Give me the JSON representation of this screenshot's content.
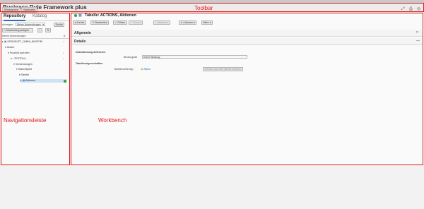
{
  "app": {
    "title": "Business Rule Framework plus",
    "toolbar_buttons": [
      "Workspace",
      "Startseite"
    ],
    "toolbar_icons": [
      "expand-icon",
      "print-icon",
      "help-icon"
    ]
  },
  "annotations": {
    "toolbar": "Toolbar",
    "navigation": "Navigationsleiste",
    "workbench": "Workbench"
  },
  "navigation": {
    "tabs": [
      "Repository",
      "Katalog"
    ],
    "anzeigen_label": "Anzeigen:",
    "anzeigen_value": "Meine Anwendungen",
    "search_button": "Suche",
    "create_app_button": "Anwendung anlegen",
    "filter_buttons": [
      "↕",
      "⇅"
    ],
    "section_label": "Meine Anwendungen",
    "section_marker": "A",
    "tree": [
      {
        "label": "ORDNSOFT_GMBH_BEISPIEL",
        "level": 0,
        "icon": "folder"
      },
      {
        "label": "Aktiver",
        "level": 1,
        "icon": "none"
      },
      {
        "label": "Prozeße aufrufen",
        "level": 2,
        "icon": "none"
      },
      {
        "label": "TESTFALL",
        "level": 3,
        "icon": "item"
      },
      {
        "label": "Verwendungen",
        "level": 3,
        "icon": "none"
      },
      {
        "label": "Datenobjekt",
        "level": 4,
        "icon": "none"
      },
      {
        "label": "Tabelle",
        "level": 5,
        "icon": "none"
      },
      {
        "label": "Aktionen",
        "level": 6,
        "icon": "table",
        "selected": true
      }
    ]
  },
  "workbench": {
    "header_title": "Tabelle: ACTIONS, Aktionen",
    "buttons": [
      "Zurück",
      "Bearbeiten",
      "Prüfen",
      "Sichern",
      "Aktivieren",
      "Löschen",
      "Mehr"
    ],
    "sections": {
      "allgemein": "Allgemein",
      "details": "Details"
    },
    "datenbindung_heading": "Datenbindung definieren",
    "bindungsart_label": "Bindungsart",
    "bindungsart_value": "Keine Bindung",
    "tabelleneigenschaften_heading": "Tabelleneigenschaften",
    "tabellenzeilentyp_label": "Tabellenzeilentyp",
    "tabellenzeilentyp_value": "Aktion",
    "struktur_button": "Struktur aus DB-Tabelle anlegen"
  },
  "colors": {
    "annotation_red": "#e01a1a",
    "status_green": "#2aa836",
    "accent_blue": "#2a6ebb"
  }
}
